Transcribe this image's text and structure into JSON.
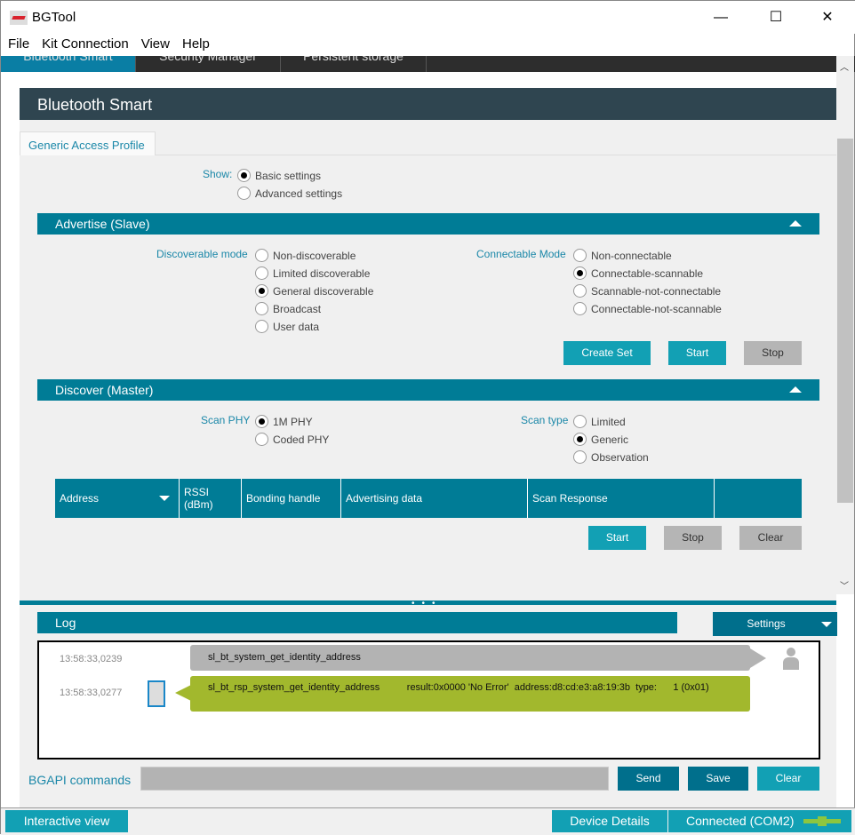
{
  "window": {
    "title": "BGTool",
    "minimize": "—",
    "maximize": "☐",
    "close": "✕"
  },
  "menu": [
    "File",
    "Kit Connection",
    "View",
    "Help"
  ],
  "main_tabs": [
    "Bluetooth Smart",
    "Security Manager",
    "Persistent storage"
  ],
  "header": "Bluetooth Smart",
  "sub_tab": "Generic Access Profile",
  "show": {
    "label": "Show:",
    "options": [
      "Basic settings",
      "Advanced settings"
    ],
    "selected": 0
  },
  "advertise": {
    "title": "Advertise (Slave)",
    "discoverable_label": "Discoverable mode",
    "discoverable": [
      "Non-discoverable",
      "Limited discoverable",
      "General discoverable",
      "Broadcast",
      "User data"
    ],
    "discoverable_selected": 2,
    "connectable_label": "Connectable Mode",
    "connectable": [
      "Non-connectable",
      "Connectable-scannable",
      "Scannable-not-connectable",
      "Connectable-not-scannable"
    ],
    "connectable_selected": 1,
    "buttons": [
      "Create Set",
      "Start",
      "Stop"
    ]
  },
  "discover": {
    "title": "Discover (Master)",
    "phy_label": "Scan PHY",
    "phy": [
      "1M PHY",
      "Coded PHY"
    ],
    "phy_selected": 0,
    "type_label": "Scan type",
    "types": [
      "Limited",
      "Generic",
      "Observation"
    ],
    "type_selected": 1,
    "columns": [
      "Address",
      "RSSI (dBm)",
      "Bonding handle",
      "Advertising data",
      "Scan Response",
      ""
    ],
    "buttons": [
      "Start",
      "Stop",
      "Clear"
    ]
  },
  "log": {
    "title": "Log",
    "settings": "Settings",
    "entries": [
      {
        "time": "13:58:33,0239",
        "text": "sl_bt_system_get_identity_address",
        "dir": "out"
      },
      {
        "time": "13:58:33,0277",
        "text": "sl_bt_rsp_system_get_identity_address          result:0x0000 'No Error'  address:d8:cd:e3:a8:19:3b  type:      1 (0x01)",
        "dir": "in"
      }
    ]
  },
  "bgapi": {
    "label": "BGAPI commands",
    "value": "",
    "send": "Send",
    "save": "Save",
    "clear": "Clear"
  },
  "statusbar": {
    "interactive": "Interactive view",
    "device": "Device Details",
    "connected": "Connected (COM2)"
  },
  "colors": {
    "teal": "#007c96",
    "button": "#12a0b4",
    "out_msg": "#b3b3b3",
    "in_msg": "#a2b82d"
  }
}
